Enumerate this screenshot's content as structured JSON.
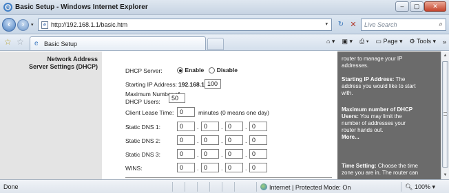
{
  "window": {
    "title": "Basic Setup - Windows Internet Explorer",
    "controls": [
      "–",
      "▢",
      "✕"
    ]
  },
  "address_bar": {
    "url": "http://192.168.1.1/basic.htm",
    "search_placeholder": "Live Search"
  },
  "tab": {
    "label": "Basic Setup"
  },
  "command_bar": {
    "page_label": "Page ▾",
    "tools_label": "Tools ▾",
    "more": "»"
  },
  "section": {
    "heading_line1": "Network Address",
    "heading_line2": "Server Settings (DHCP)"
  },
  "form": {
    "dhcp_server_label": "DHCP Server:",
    "enable_label": "Enable",
    "disable_label": "Disable",
    "dhcp_selected": "Enable",
    "starting_ip_label": "Starting IP Address:",
    "starting_ip_prefix": "192.168.1.",
    "starting_ip_value": "100",
    "max_users_label_1": "Maximum Number of",
    "max_users_label_2": "DHCP Users:",
    "max_users_value": "50",
    "lease_time_label": "Client Lease Time:",
    "lease_time_value": "0",
    "lease_time_unit": "minutes (0 means one day)",
    "dns1_label": "Static DNS 1:",
    "dns2_label": "Static DNS 2:",
    "dns3_label": "Static DNS 3:",
    "wins_label": "WINS:",
    "dns1": [
      "0",
      "0",
      "0",
      "0"
    ],
    "dns2": [
      "0",
      "0",
      "0",
      "0"
    ],
    "dns3": [
      "0",
      "0",
      "0",
      "0"
    ],
    "wins": [
      "0",
      "0",
      "0",
      "0"
    ]
  },
  "help": {
    "intro_1": "router to manage your IP",
    "intro_2": "addresses.",
    "starting_title": "Starting IP Address:",
    "starting_rest_1": " The",
    "starting_rest_2": "address you would like to start",
    "starting_rest_3": "with.",
    "maxnum_title_1": "Maximum number of DHCP",
    "maxnum_title_2": "Users:",
    "maxnum_rest_1": " You may limit the",
    "maxnum_rest_2": "number of addresses your",
    "maxnum_rest_3": "router hands out.",
    "more": "More...",
    "time_title": "Time Setting:",
    "time_rest_1": " Choose the time",
    "time_rest_2": "zone you are in. The router can"
  },
  "status_bar": {
    "status": "Done",
    "zone": "Internet | Protected Mode: On",
    "zoom": "100%"
  },
  "colors": {
    "help_bg": "#6b6b6b",
    "left_bg": "#e4e4e4",
    "chrome_blue": "#c9d7e7"
  }
}
